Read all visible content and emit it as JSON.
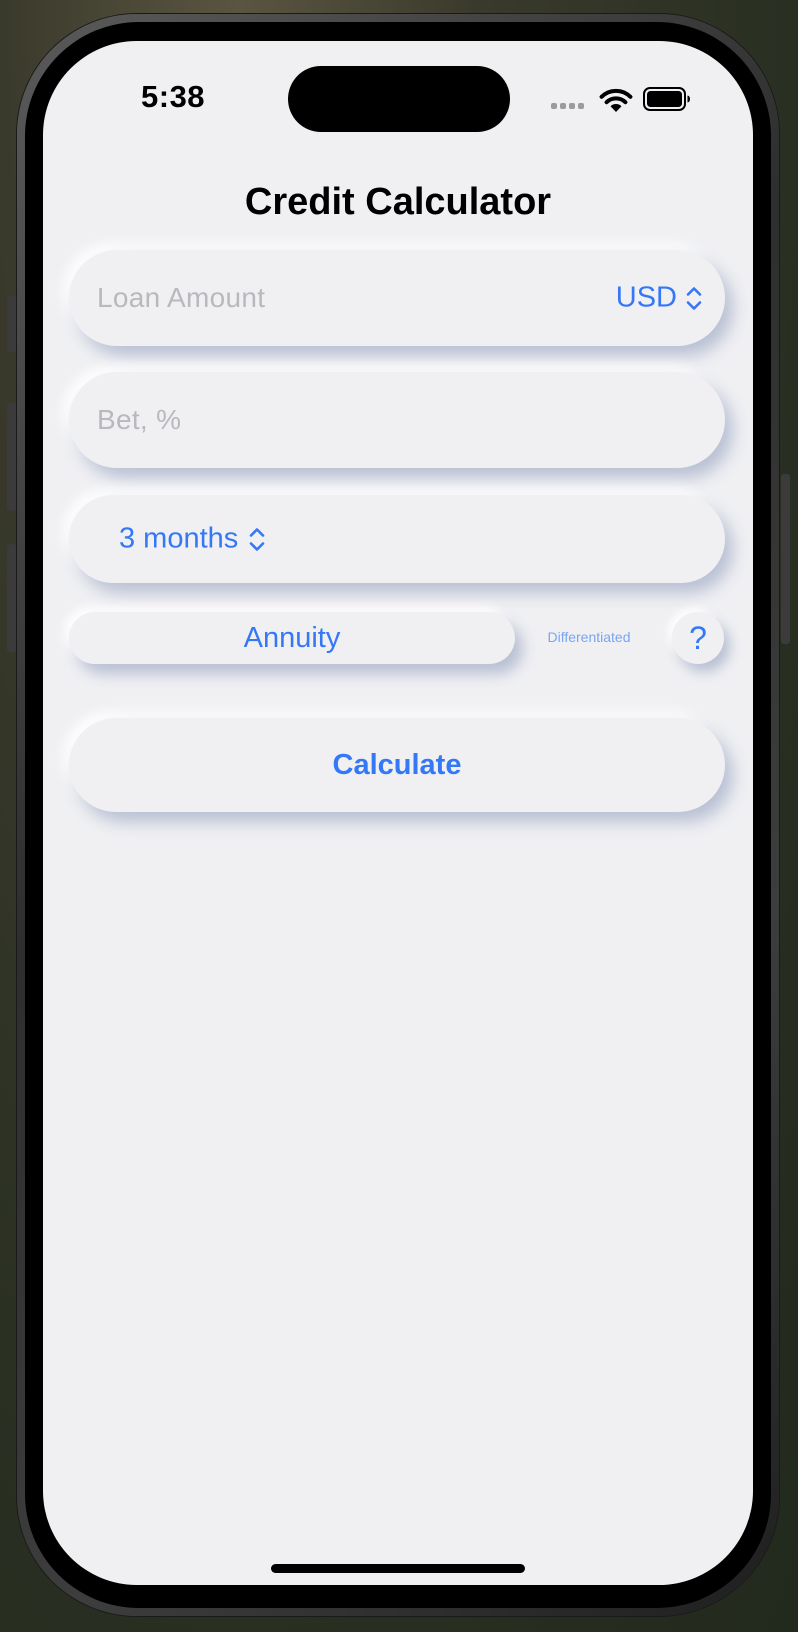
{
  "status_bar": {
    "time": "5:38",
    "icons": [
      "signal-dots-icon",
      "wifi-icon",
      "battery-icon"
    ]
  },
  "header": {
    "title": "Credit Calculator"
  },
  "form": {
    "loan_amount_placeholder": "Loan Amount",
    "currency": "USD",
    "rate_placeholder": "Bet, %",
    "term": "3 months"
  },
  "payment_type": {
    "selected": "Annuity",
    "other": "Differentiated",
    "help_label": "?"
  },
  "actions": {
    "calculate_label": "Calculate"
  },
  "colors": {
    "accent": "#3478f6",
    "background": "#f0f0f3",
    "placeholder": "#b9b9bd"
  }
}
